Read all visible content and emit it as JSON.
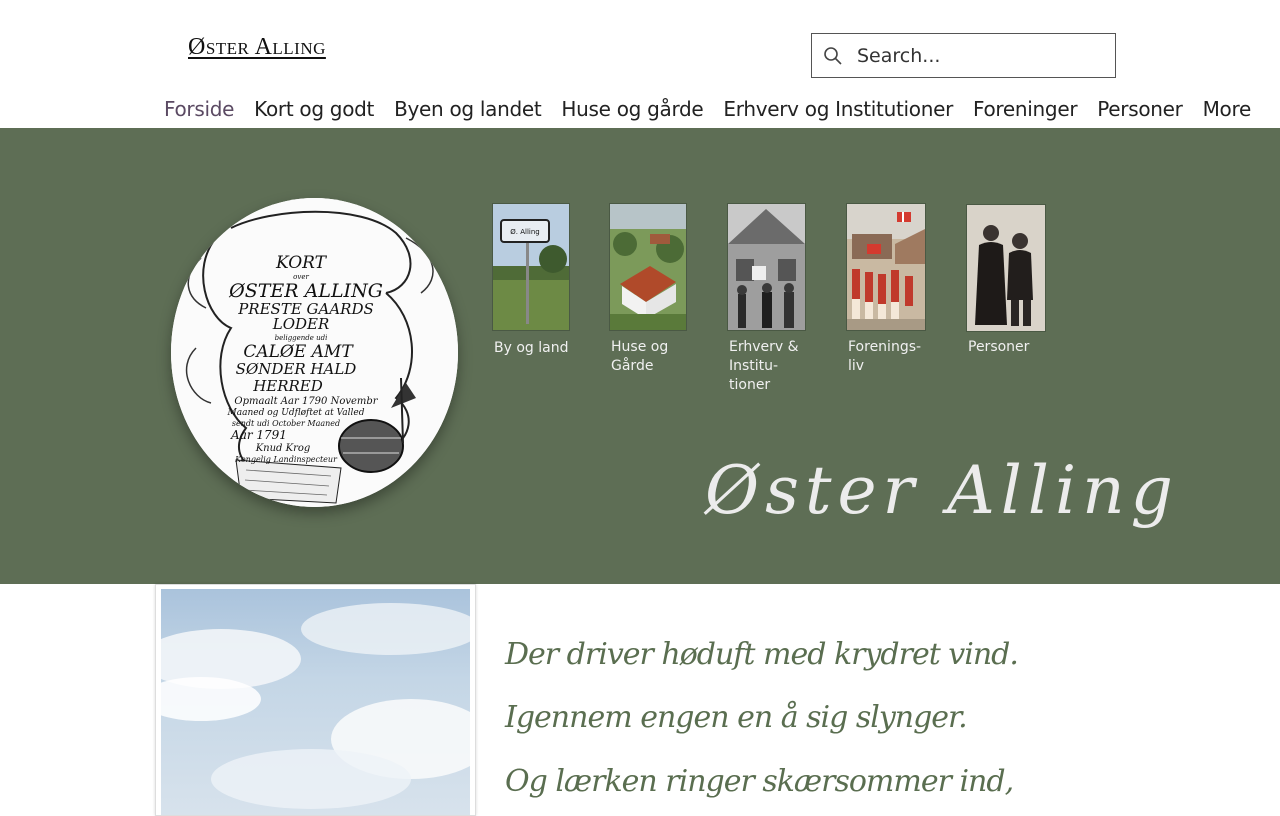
{
  "header": {
    "site_title": "Øster Alling",
    "search_placeholder": "Search..."
  },
  "nav": {
    "items": [
      {
        "label": "Forside"
      },
      {
        "label": "Kort og godt"
      },
      {
        "label": "Byen og landet"
      },
      {
        "label": "Huse og gårde"
      },
      {
        "label": "Erhverv og Institutioner"
      },
      {
        "label": "Foreninger"
      },
      {
        "label": "Personer"
      },
      {
        "label": "More"
      }
    ]
  },
  "hero": {
    "background_color": "#5e6e55",
    "title": "Øster Alling",
    "medallion": {
      "lines": [
        "KORT",
        "over",
        "ØSTER ALLING",
        "PRESTE GAARDS",
        "LODER",
        "beliggende udi",
        "CALØE AMT",
        "SØNDER HALD",
        "HERRED",
        "Opmaalt Aar 1790 Novembr",
        "Maaned og Udfløftet at Valled",
        "sendt udi October Maaned",
        "Aar 1791",
        "Knud Krog",
        "Kongelig Landinspecteur"
      ]
    },
    "thumbs": [
      {
        "label_lines": [
          "By og land"
        ],
        "sign_text": "Ø. Alling"
      },
      {
        "label_lines": [
          "Huse og",
          "Gårde"
        ]
      },
      {
        "label_lines": [
          "Erhverv &",
          "Institu-",
          "tioner"
        ]
      },
      {
        "label_lines": [
          "Forenings-",
          "liv"
        ]
      },
      {
        "label_lines": [
          "Personer"
        ]
      }
    ]
  },
  "poem": {
    "lines": [
      "Der driver høduft med krydret vind.",
      "Igennem engen en å sig slynger.",
      "Og lærken ringer skærsommer ind,"
    ]
  }
}
